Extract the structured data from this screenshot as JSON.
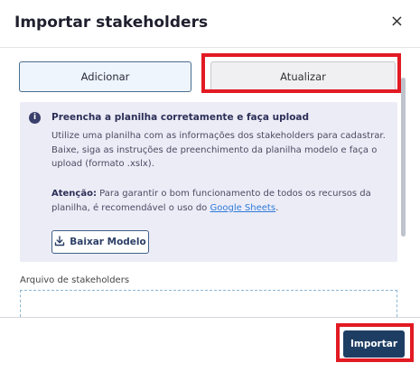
{
  "dialog": {
    "title": "Importar stakeholders",
    "close_icon": "close-icon",
    "close_glyph": "×"
  },
  "tabs": [
    {
      "label": "Adicionar",
      "active": true
    },
    {
      "label": "Atualizar",
      "active": false
    }
  ],
  "info": {
    "icon": "info-icon",
    "icon_glyph": "i",
    "title": "Preencha a planilha corretamente e faça upload",
    "body": "Utilize uma planilha com as informações dos stakeholders para cadastrar. Baixe, siga as instruções de preenchimento da planilha modelo e faça o upload (formato .xslx).",
    "warning_label": "Atenção:",
    "warning_text": " Para garantir o bom funcionamento de todos os recursos da planilha, é recomendável o uso do ",
    "warning_link": "Google Sheets",
    "warning_end": ".",
    "download_icon": "download-icon",
    "download_label": "Baixar Modelo"
  },
  "upload": {
    "label": "Arquivo de stakeholders"
  },
  "footer": {
    "import_label": "Importar"
  },
  "colors": {
    "highlight": "#e21a23",
    "primary": "#1e3d63",
    "info_bg": "#ececf7",
    "link": "#2f7bd6"
  }
}
